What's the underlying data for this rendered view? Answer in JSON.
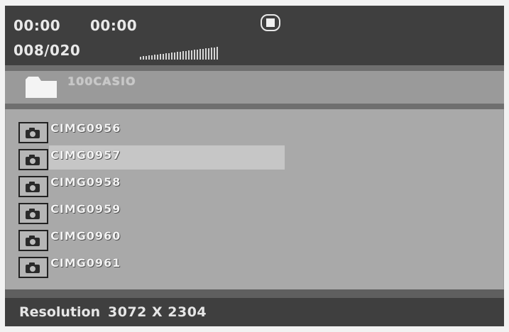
{
  "header": {
    "current_time": "00:00",
    "total_time": "00:00",
    "file_counter": "008/020",
    "stop_icon": "stop-icon",
    "volume_level": 0.7
  },
  "folder": {
    "icon": "folder-icon",
    "name": "100CASIO"
  },
  "files": [
    {
      "name": "CIMG0956",
      "icon": "camera-icon",
      "selected": false
    },
    {
      "name": "CIMG0957",
      "icon": "camera-icon",
      "selected": true
    },
    {
      "name": "CIMG0958",
      "icon": "camera-icon",
      "selected": false
    },
    {
      "name": "CIMG0959",
      "icon": "camera-icon",
      "selected": false
    },
    {
      "name": "CIMG0960",
      "icon": "camera-icon",
      "selected": false
    },
    {
      "name": "CIMG0961",
      "icon": "camera-icon",
      "selected": false
    }
  ],
  "footer": {
    "resolution_label": "Resolution",
    "resolution_value": "3072 X 2304"
  },
  "colors": {
    "header_bg": "#3f3f3f",
    "panel_bg": "#a9a9a9",
    "highlight": "#c6c6c6"
  }
}
